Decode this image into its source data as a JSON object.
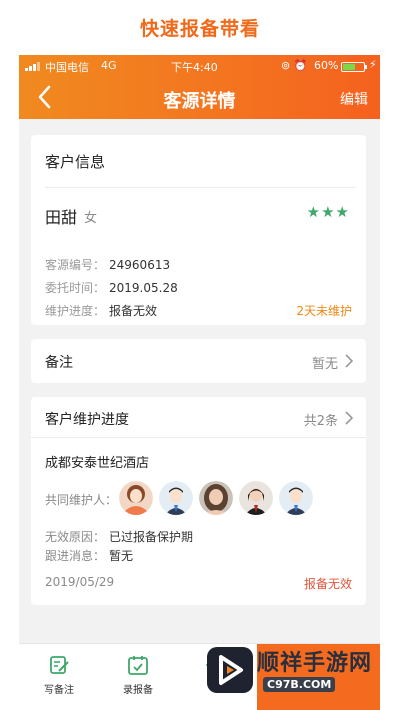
{
  "banner": {
    "title": "快速报备带看"
  },
  "status_bar": {
    "carrier": "中国电信",
    "network": "4G",
    "time": "下午4:40",
    "battery": "60%",
    "battery_level": 0.6
  },
  "header": {
    "title": "客源详情",
    "edit_label": "编辑",
    "back_icon": "chevron-left-icon"
  },
  "customer": {
    "section_title": "客户信息",
    "name": "田甜",
    "gender": "女",
    "rating": "★★★",
    "rating_value": 3,
    "rating_color": "#3fa86a",
    "rows": [
      {
        "label": "客源编号：",
        "value": "24960613"
      },
      {
        "label": "委托时间：",
        "value": "2019.05.28"
      },
      {
        "label": "维护进度：",
        "value": "报备无效"
      }
    ],
    "warning": "2天未维护"
  },
  "note": {
    "label": "备注",
    "value": "暂无"
  },
  "progress": {
    "title": "客户维护进度",
    "count": "共2条",
    "hotel": "成都安泰世纪酒店",
    "co_label": "共同维护人：",
    "invalid_label": "无效原因：",
    "invalid_value": "已过报备保护期",
    "follow_label": "跟进消息：",
    "follow_value": "暂无",
    "date": "2019/05/29",
    "status": "报备无效"
  },
  "tabbar": {
    "items": [
      {
        "label": "写备注",
        "icon": "edit-note-icon"
      },
      {
        "label": "录报备",
        "icon": "calendar-check-icon"
      },
      {
        "label": "",
        "icon": "eye-icon"
      }
    ]
  },
  "watermark": {
    "title": "顺祥手游网",
    "sub": "C97B.COM"
  },
  "colors": {
    "accent": "#f47320",
    "warning": "#ee8a18",
    "invalid": "#e0553a",
    "tab_icon": "#3fa86a"
  }
}
